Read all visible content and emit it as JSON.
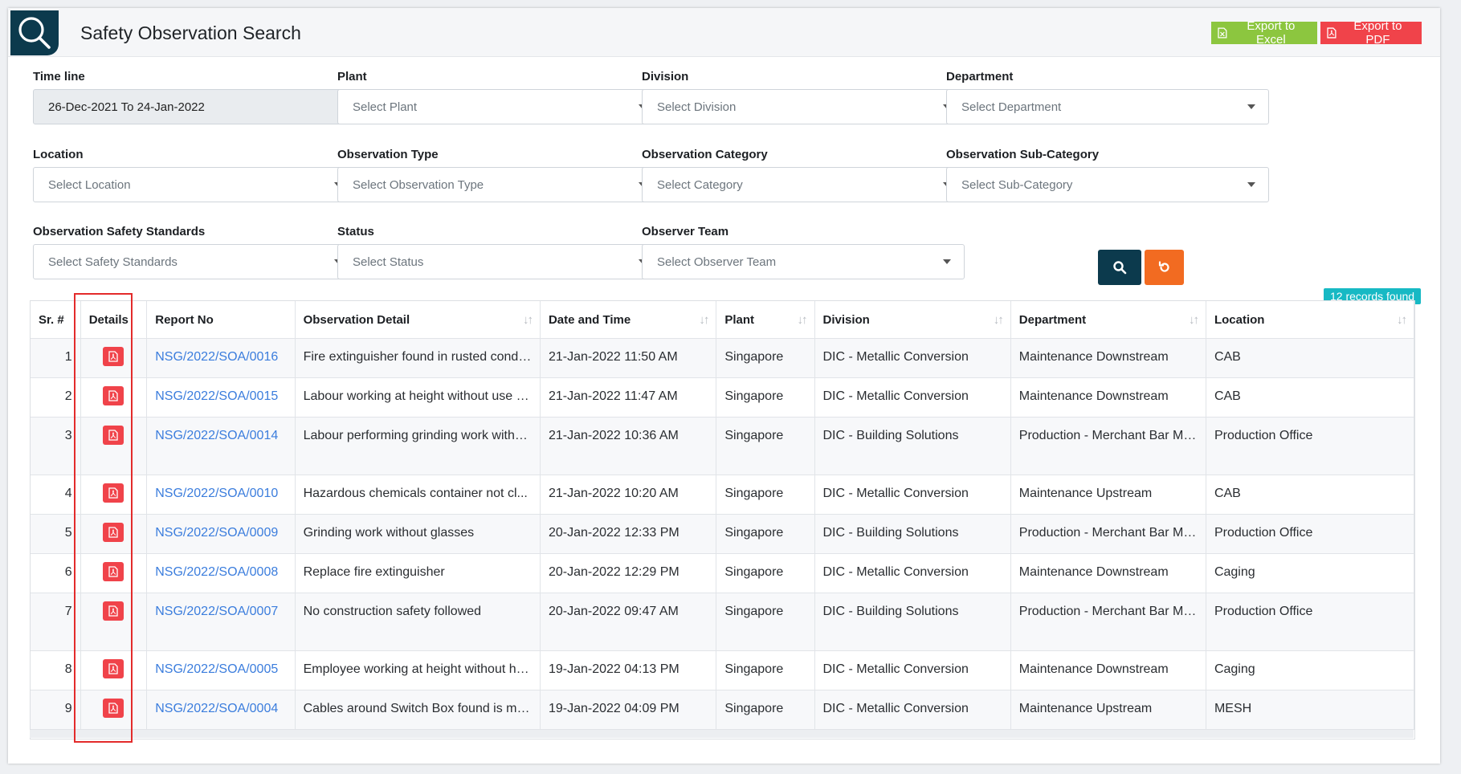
{
  "header": {
    "title": "Safety Observation Search",
    "export_excel": "Export to Excel",
    "export_pdf": "Export to PDF"
  },
  "filters": {
    "timeline": {
      "label": "Time line",
      "value": "26-Dec-2021 To 24-Jan-2022"
    },
    "plant": {
      "label": "Plant",
      "placeholder": "Select Plant"
    },
    "division": {
      "label": "Division",
      "placeholder": "Select Division"
    },
    "department": {
      "label": "Department",
      "placeholder": "Select Department"
    },
    "location": {
      "label": "Location",
      "placeholder": "Select Location"
    },
    "obs_type": {
      "label": "Observation Type",
      "placeholder": "Select Observation Type"
    },
    "obs_category": {
      "label": "Observation Category",
      "placeholder": "Select Category"
    },
    "obs_subcategory": {
      "label": "Observation Sub-Category",
      "placeholder": "Select Sub-Category"
    },
    "safety_standards": {
      "label": "Observation Safety Standards",
      "placeholder": "Select Safety Standards"
    },
    "status": {
      "label": "Status",
      "placeholder": "Select Status"
    },
    "observer_team": {
      "label": "Observer Team",
      "placeholder": "Select Observer Team"
    }
  },
  "records_badge": "12 records found",
  "table": {
    "headers": [
      "Sr. #",
      "Details",
      "Report No",
      "Observation Detail",
      "Date and Time",
      "Plant",
      "Division",
      "Department",
      "Location"
    ],
    "rows": [
      {
        "sr": "1",
        "report": "NSG/2022/SOA/0016",
        "detail": "Fire extinguisher found in rusted condi...",
        "datetime": "21-Jan-2022 11:50 AM",
        "plant": "Singapore",
        "division": "DIC - Metallic Conversion",
        "department": "Maintenance Downstream",
        "location": "CAB"
      },
      {
        "sr": "2",
        "report": "NSG/2022/SOA/0015",
        "detail": "Labour working at height without use o...",
        "datetime": "21-Jan-2022 11:47 AM",
        "plant": "Singapore",
        "division": "DIC - Metallic Conversion",
        "department": "Maintenance Downstream",
        "location": "CAB"
      },
      {
        "sr": "3",
        "report": "NSG/2022/SOA/0014",
        "detail": "Labour performing grinding work witho...",
        "datetime": "21-Jan-2022 10:36 AM",
        "plant": "Singapore",
        "division": "DIC - Building Solutions",
        "department": "Production - Merchant Bar Mills",
        "location": "Production Office"
      },
      {
        "sr": "4",
        "report": "NSG/2022/SOA/0010",
        "detail": "Hazardous chemicals container not cl...",
        "datetime": "21-Jan-2022 10:20 AM",
        "plant": "Singapore",
        "division": "DIC - Metallic Conversion",
        "department": "Maintenance Upstream",
        "location": "CAB"
      },
      {
        "sr": "5",
        "report": "NSG/2022/SOA/0009",
        "detail": "Grinding work without glasses",
        "datetime": "20-Jan-2022 12:33 PM",
        "plant": "Singapore",
        "division": "DIC - Building Solutions",
        "department": "Production - Merchant Bar Mills",
        "location": "Production Office"
      },
      {
        "sr": "6",
        "report": "NSG/2022/SOA/0008",
        "detail": "Replace fire extinguisher",
        "datetime": "20-Jan-2022 12:29 PM",
        "plant": "Singapore",
        "division": "DIC - Metallic Conversion",
        "department": "Maintenance Downstream",
        "location": "Caging"
      },
      {
        "sr": "7",
        "report": "NSG/2022/SOA/0007",
        "detail": "No construction safety followed",
        "datetime": "20-Jan-2022 09:47 AM",
        "plant": "Singapore",
        "division": "DIC - Building Solutions",
        "department": "Production - Merchant Bar Mills",
        "location": "Production Office"
      },
      {
        "sr": "8",
        "report": "NSG/2022/SOA/0005",
        "detail": "Employee working at height without ha...",
        "datetime": "19-Jan-2022 04:13 PM",
        "plant": "Singapore",
        "division": "DIC - Metallic Conversion",
        "department": "Maintenance Downstream",
        "location": "Caging"
      },
      {
        "sr": "9",
        "report": "NSG/2022/SOA/0004",
        "detail": "Cables around Switch Box found is me...",
        "datetime": "19-Jan-2022 04:09 PM",
        "plant": "Singapore",
        "division": "DIC - Metallic Conversion",
        "department": "Maintenance Upstream",
        "location": "MESH"
      }
    ]
  }
}
